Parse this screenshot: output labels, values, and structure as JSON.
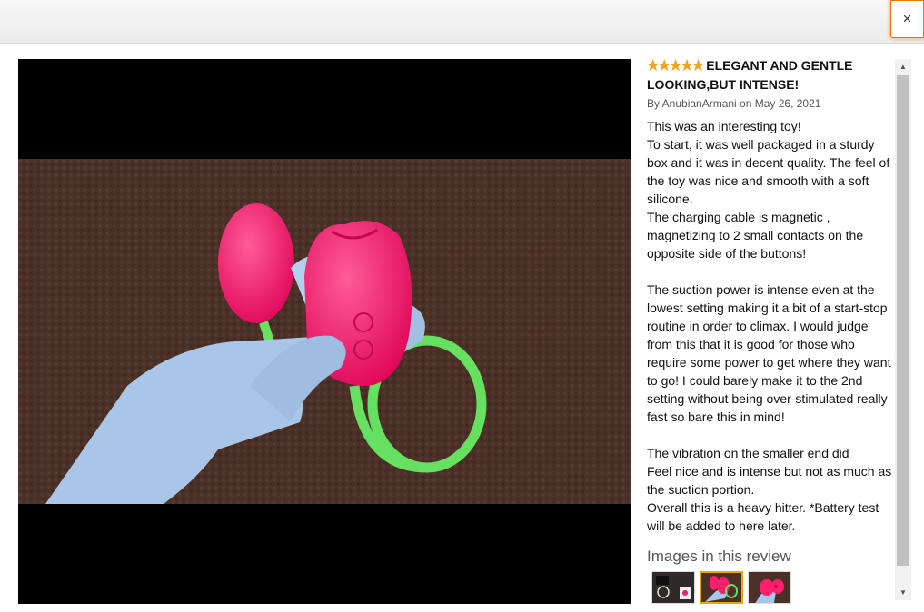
{
  "dialog": {
    "close_label": "×"
  },
  "review": {
    "stars_glyph": "★★★★★",
    "rating": 5,
    "rating_max": 5,
    "title": "ELEGANT AND GENTLE LOOKING,BUT INTENSE!",
    "byline": "By AnubianArmani on May 26, 2021",
    "body": "This was an interesting toy!\nTo start, it was well packaged in a sturdy box and it was in decent quality. The feel of the toy was nice and smooth with a soft silicone.\nThe charging cable is magnetic , magnetizing to 2 small contacts on the opposite side of the buttons!\n\nThe suction power is intense even at the lowest setting making it a bit of a start-stop routine in order to climax. I would judge from this that it is good for those who require some power to get where they want to go! I could barely make it to the 2nd setting without being over-stimulated really fast so bare this in mind!\n\nThe vibration on the smaller end did\nFeel nice and is intense but not as much as the suction portion.\nOverall this is a heavy hitter. *Battery test will be added to here later.",
    "images_heading": "Images in this review"
  },
  "colors": {
    "star": "#f7a21a",
    "selected_thumb_border": "#e7a617",
    "close_focus": "#e77600",
    "product_pink": "#ff1f6e",
    "cable_green": "#66e060",
    "glove_blue": "#a9c6e8"
  },
  "thumbnails": [
    {
      "name": "thumb-packaging",
      "selected": false
    },
    {
      "name": "thumb-product-in-hand",
      "selected": true
    },
    {
      "name": "thumb-product-closeup",
      "selected": false
    }
  ],
  "scrollbar": {
    "up_arrow": "▲",
    "down_arrow": "▼"
  }
}
